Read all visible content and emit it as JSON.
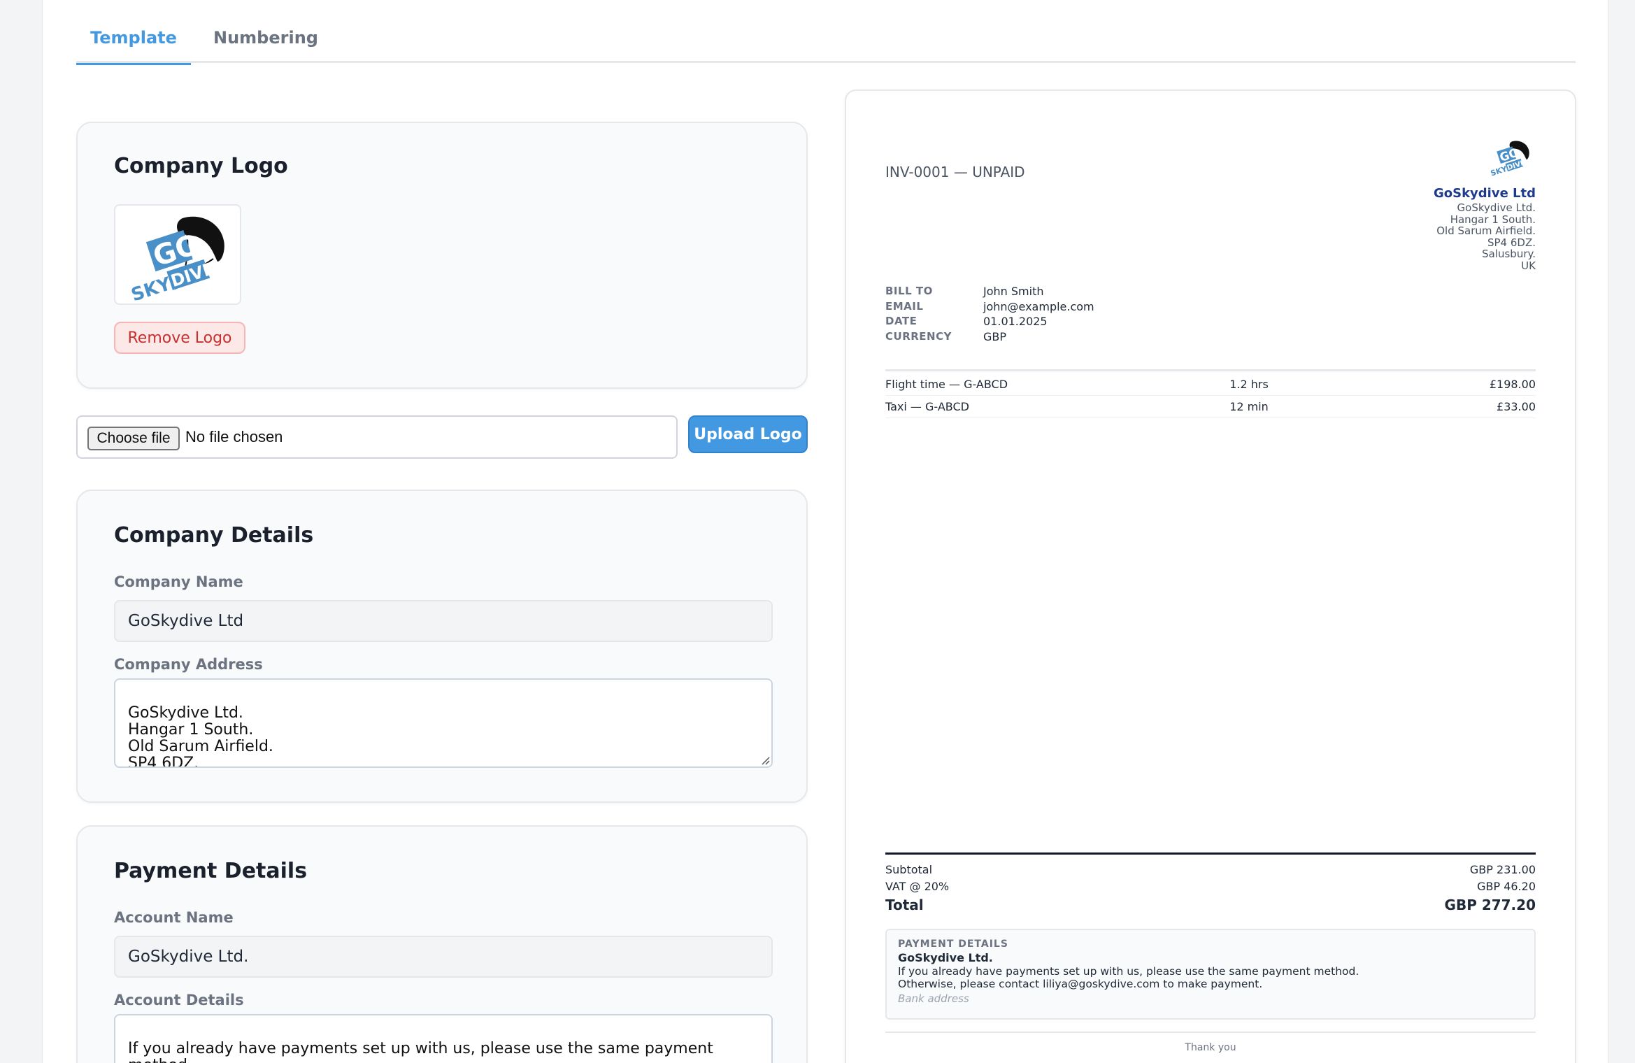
{
  "tabs": [
    {
      "label": "Template",
      "active": true
    },
    {
      "label": "Numbering",
      "active": false
    }
  ],
  "logo_card": {
    "title": "Company Logo",
    "logo_alt": "GoSkydive logo",
    "remove_label": "Remove Logo"
  },
  "upload": {
    "choose_label": "Choose file",
    "no_file_text": "No file chosen",
    "upload_label": "Upload Logo"
  },
  "company_card": {
    "title": "Company Details",
    "name_label": "Company Name",
    "name_value": "GoSkydive Ltd",
    "address_label": "Company Address",
    "address_value": "GoSkydive Ltd.\nHangar 1 South.\nOld Sarum Airfield.\nSP4 6DZ.\nSalusbury."
  },
  "payment_card": {
    "title": "Payment Details",
    "account_name_label": "Account Name",
    "account_name_value": "GoSkydive Ltd.",
    "account_details_label": "Account Details",
    "account_details_value": "If you already have payments set up with us, please use the same payment method.\nOtherwise, please contact liliya@goskydive.com to make payment."
  },
  "invoice": {
    "id_status": "INV-0001 — UNPAID",
    "company_name": "GoSkydive Ltd",
    "company_address": [
      "GoSkydive Ltd.",
      "Hangar 1 South.",
      "Old Sarum Airfield.",
      "SP4 6DZ.",
      "Salusbury.",
      "UK"
    ],
    "bill_rows": [
      {
        "key": "BILL TO",
        "value": "John Smith"
      },
      {
        "key": "EMAIL",
        "value": "john@example.com"
      },
      {
        "key": "DATE",
        "value": "01.01.2025"
      },
      {
        "key": "CURRENCY",
        "value": "GBP"
      }
    ],
    "items": [
      {
        "desc": "Flight time — G-ABCD",
        "qty": "1.2 hrs",
        "amount": "£198.00"
      },
      {
        "desc": "Taxi — G-ABCD",
        "qty": "12 min",
        "amount": "£33.00"
      }
    ],
    "subtotal_label": "Subtotal",
    "subtotal_value": "GBP 231.00",
    "vat_label": "VAT @ 20%",
    "vat_value": "GBP 46.20",
    "total_label": "Total",
    "total_value": "GBP 277.20",
    "payment_title": "PAYMENT DETAILS",
    "payment_name": "GoSkydive Ltd.",
    "payment_text": "If you already have payments set up with us, please use the same payment method.\nOtherwise, please contact liliya@goskydive.com to make payment.",
    "bank_placeholder": "Bank address",
    "thanks": "Thank you"
  },
  "colors": {
    "accent": "#4299e1",
    "danger": "#c53030",
    "company_name": "#1e3a8a",
    "logo_blue": "#4a90c8"
  }
}
